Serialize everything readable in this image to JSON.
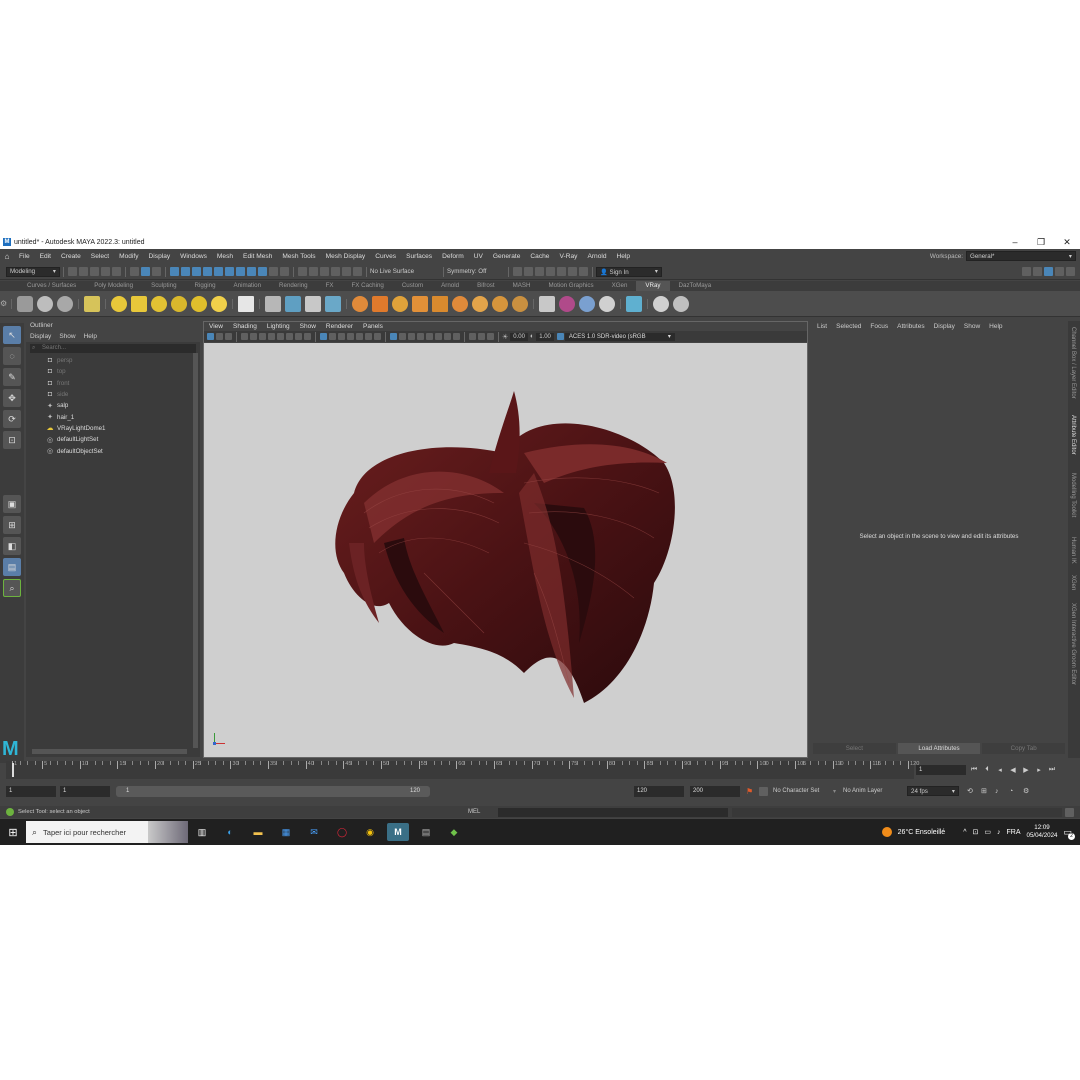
{
  "window": {
    "title": "untitled* - Autodesk MAYA 2022.3: untitled",
    "controls": [
      "–",
      "❐",
      "✕"
    ]
  },
  "menubar": {
    "items": [
      "File",
      "Edit",
      "Create",
      "Select",
      "Modify",
      "Display",
      "Windows",
      "Mesh",
      "Edit Mesh",
      "Mesh Tools",
      "Mesh Display",
      "Curves",
      "Surfaces",
      "Deform",
      "UV",
      "Generate",
      "Cache",
      "V-Ray",
      "Arnold",
      "Help"
    ],
    "workspace_label": "Workspace:",
    "workspace_value": "General*"
  },
  "statusline": {
    "mode": "Modeling",
    "live_surface": "No Live Surface",
    "symmetry": "Symmetry: Off",
    "sign_in": "Sign In"
  },
  "shelf": {
    "tabs": [
      "Curves / Surfaces",
      "Poly Modeling",
      "Sculpting",
      "Rigging",
      "Animation",
      "Rendering",
      "FX",
      "FX Caching",
      "Custom",
      "Arnold",
      "Bifrost",
      "MASH",
      "Motion Graphics",
      "XGen",
      "VRay",
      "DazToMaya"
    ],
    "active_tab": "VRay"
  },
  "outliner": {
    "title": "Outliner",
    "menu": [
      "Display",
      "Show",
      "Help"
    ],
    "search_placeholder": "Search...",
    "items": [
      {
        "label": "persp",
        "dim": true,
        "icon": "camera-icon"
      },
      {
        "label": "top",
        "dim": true,
        "icon": "camera-icon"
      },
      {
        "label": "front",
        "dim": true,
        "icon": "camera-icon"
      },
      {
        "label": "side",
        "dim": true,
        "icon": "camera-icon"
      },
      {
        "label": "salp",
        "dim": false,
        "icon": "transform-icon"
      },
      {
        "label": "hair_1",
        "dim": false,
        "icon": "transform-icon"
      },
      {
        "label": "VRayLightDome1",
        "dim": false,
        "icon": "light-dome-icon"
      },
      {
        "label": "defaultLightSet",
        "dim": false,
        "icon": "set-icon"
      },
      {
        "label": "defaultObjectSet",
        "dim": false,
        "icon": "set-icon"
      }
    ]
  },
  "viewport": {
    "menu": [
      "View",
      "Shading",
      "Lighting",
      "Show",
      "Renderer",
      "Panels"
    ],
    "exposure": "0.00",
    "gamma": "1.00",
    "colorspace": "ACES 1.0 SDR-video (sRGB"
  },
  "attribute_editor": {
    "menu": [
      "List",
      "Selected",
      "Focus",
      "Attributes",
      "Display",
      "Show",
      "Help"
    ],
    "message": "Select an object in the scene to view and edit its attributes",
    "buttons": [
      "Select",
      "Load Attributes",
      "Copy Tab"
    ]
  },
  "side_tabs": [
    "Channel Box / Layer Editor",
    "Attribute Editor",
    "Modelling Toolkit",
    "Human IK",
    "XGen",
    "XGen Interactive Groom Editor"
  ],
  "timeline": {
    "tick_labels": [
      "1",
      "5",
      "10",
      "15",
      "20",
      "25",
      "30",
      "35",
      "40",
      "45",
      "50",
      "55",
      "60",
      "65",
      "70",
      "75",
      "80",
      "85",
      "90",
      "95",
      "100",
      "105",
      "110",
      "115",
      "120"
    ],
    "current_frame": "1"
  },
  "range": {
    "start": "1",
    "playback_start": "1",
    "slider_start": "1",
    "slider_end": "120",
    "playback_end": "120",
    "end": "200",
    "character_set": "No Character Set",
    "anim_layer": "No Anim Layer",
    "fps": "24 fps"
  },
  "helpline": {
    "text": "Select Tool: select an object",
    "mel": "MEL"
  },
  "taskbar": {
    "search": "Taper ici pour rechercher",
    "weather": "26°C  Ensoleillé",
    "lang": "FRA",
    "time": "12:09",
    "date": "05/04/2024",
    "notif": "2"
  }
}
